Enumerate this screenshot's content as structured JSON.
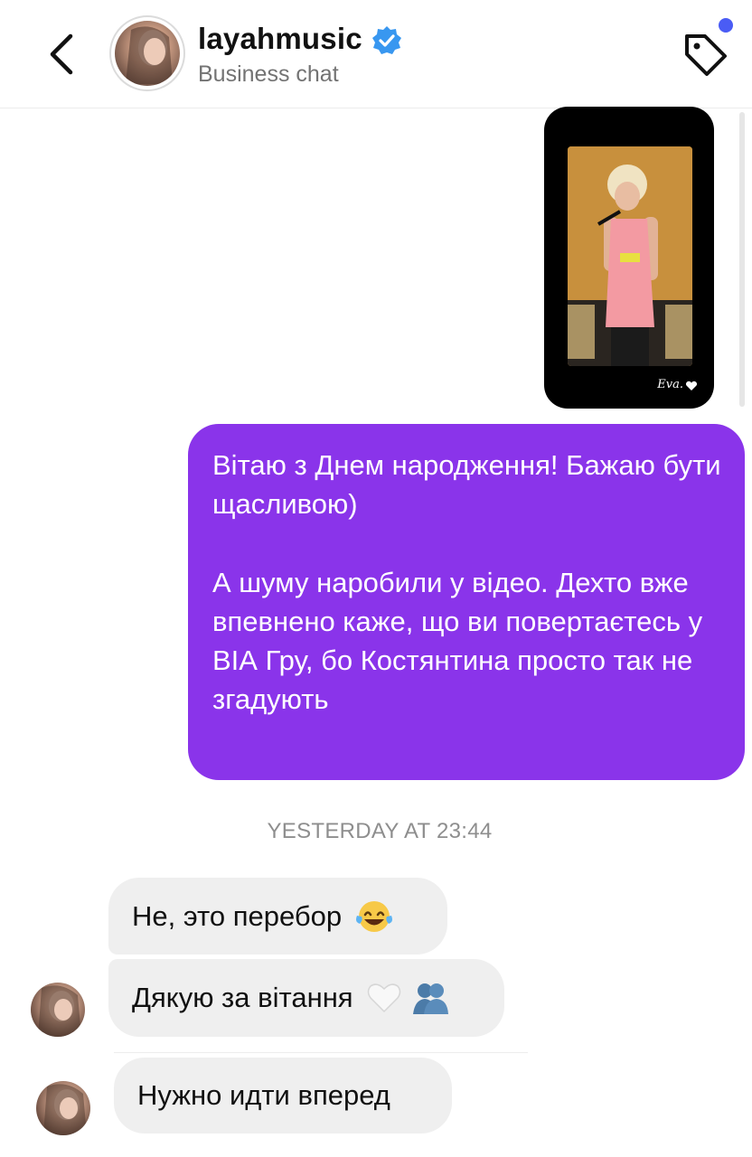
{
  "header": {
    "username": "layahmusic",
    "subtitle": "Business chat"
  },
  "shared_post": {
    "caption": "Eva."
  },
  "messages_out": {
    "line1": "Вітаю з Днем народження! Бажаю бути щасливою)",
    "line2": "А шуму наробили у відео. Дехто вже впевнено каже, що ви повертаєтесь у ВІА Гру, бо Костянтина просто так не згадують"
  },
  "timestamp": "YESTERDAY AT 23:44",
  "messages_in": [
    {
      "text": "Не, это перебор",
      "emoji": "face-with-tears-of-joy"
    },
    {
      "text": "Дякую за вітання",
      "emoji": "white-heart, people-hugging"
    },
    {
      "text": "Нужно идти вперед",
      "emoji": ""
    }
  ],
  "colors": {
    "outgoing_bubble": "#8a34ea",
    "incoming_bubble": "#efefef",
    "verified": "#3897f0",
    "notification_dot": "#4a5cf5"
  }
}
